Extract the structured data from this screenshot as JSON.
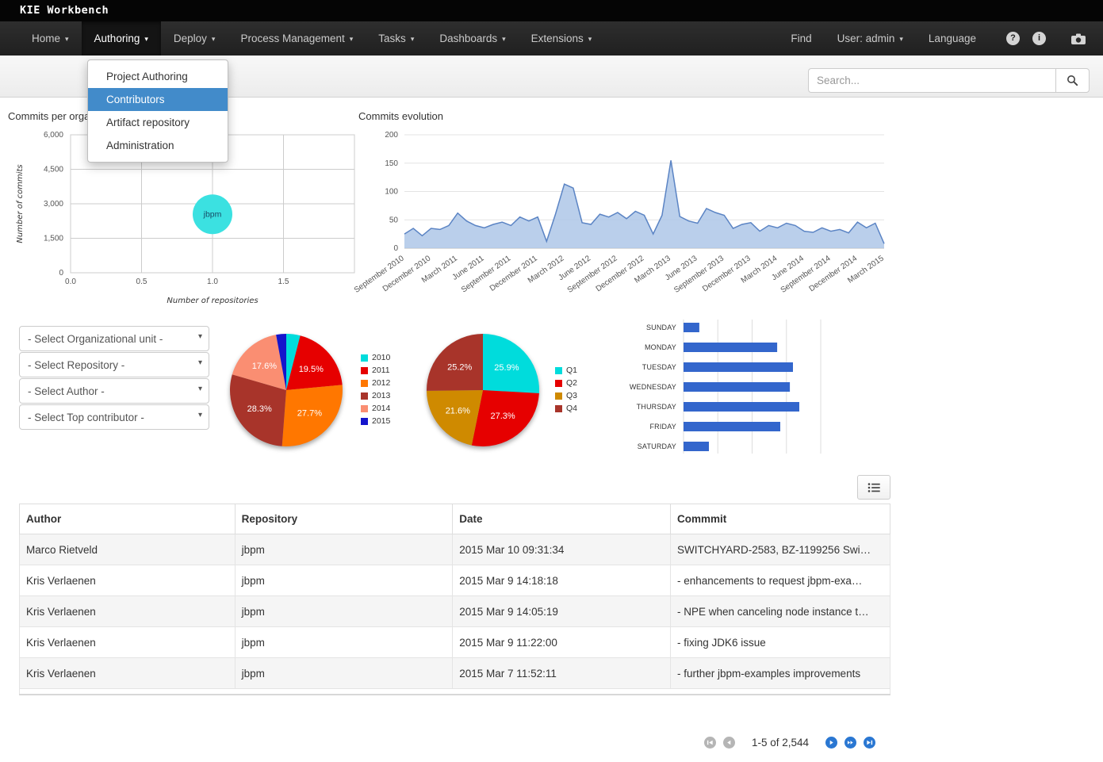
{
  "app": {
    "title": "KIE Workbench"
  },
  "navbar": {
    "items": [
      {
        "label": "Home",
        "caret": true,
        "active": false
      },
      {
        "label": "Authoring",
        "caret": true,
        "active": true
      },
      {
        "label": "Deploy",
        "caret": true,
        "active": false
      },
      {
        "label": "Process Management",
        "caret": true,
        "active": false
      },
      {
        "label": "Tasks",
        "caret": true,
        "active": false
      },
      {
        "label": "Dashboards",
        "caret": true,
        "active": false
      },
      {
        "label": "Extensions",
        "caret": true,
        "active": false
      }
    ],
    "right_items": [
      {
        "label": "Find",
        "caret": false
      },
      {
        "label": "User: admin",
        "caret": true
      },
      {
        "label": "Language",
        "caret": false
      }
    ],
    "icon_names": [
      "help-icon",
      "info-icon",
      "screenshot-icon"
    ]
  },
  "authoring_menu": {
    "items": [
      {
        "label": "Project Authoring",
        "selected": false
      },
      {
        "label": "Contributors",
        "selected": true
      },
      {
        "label": "Artifact repository",
        "selected": false
      },
      {
        "label": "Administration",
        "selected": false
      }
    ]
  },
  "search": {
    "placeholder": "Search..."
  },
  "filters": [
    "- Select Organizational unit -",
    "- Select Repository -",
    "- Select Author -",
    "- Select Top contributor -"
  ],
  "chart_data": [
    {
      "type": "scatter",
      "title": "Commits per organization",
      "xlabel": "Number of repositories",
      "ylabel": "Number of commits",
      "xlim": [
        0,
        2
      ],
      "ylim": [
        0,
        6000
      ],
      "xticks": [
        0,
        0.5,
        1,
        1.5
      ],
      "yticks": [
        0,
        1500,
        3000,
        4500,
        6000
      ],
      "points": [
        {
          "label": "jbpm",
          "x": 1,
          "y": 2544,
          "color": "#3be1e1"
        }
      ]
    },
    {
      "type": "area",
      "title": "Commits evolution",
      "ylim": [
        0,
        200
      ],
      "yticks": [
        0,
        50,
        100,
        150,
        200
      ],
      "label_every": 3,
      "x": [
        "September 2010",
        "December 2010",
        "March 2011",
        "June 2011",
        "September 2011",
        "December 2011",
        "March 2012",
        "June 2012",
        "September 2012",
        "December 2012",
        "March 2013",
        "June 2013",
        "September 2013",
        "December 2013",
        "March 2014",
        "June 2014",
        "September 2014",
        "December 2014",
        "March 2015"
      ],
      "values": [
        25,
        35,
        22,
        35,
        33,
        40,
        62,
        48,
        40,
        36,
        42,
        46,
        40,
        55,
        48,
        55,
        12,
        60,
        113,
        106,
        45,
        42,
        60,
        55,
        63,
        52,
        65,
        58,
        25,
        58,
        155,
        56,
        48,
        44,
        70,
        63,
        58,
        35,
        42,
        45,
        30,
        40,
        36,
        44,
        40,
        30,
        28,
        36,
        30,
        33,
        27,
        46,
        36,
        44,
        8
      ],
      "fill": "#aec7e8",
      "line": "#5b84c4"
    },
    {
      "type": "pie",
      "slices": [
        {
          "label": "2010",
          "value": 4.0,
          "color": "#00dcdc"
        },
        {
          "label": "2011",
          "value": 19.5,
          "color": "#e60000"
        },
        {
          "label": "2012",
          "value": 27.7,
          "color": "#ff7700"
        },
        {
          "label": "2013",
          "value": 28.3,
          "color": "#a8342a"
        },
        {
          "label": "2014",
          "value": 17.6,
          "color": "#fa8e72"
        },
        {
          "label": "2015",
          "value": 2.9,
          "color": "#1414cc"
        }
      ]
    },
    {
      "type": "pie",
      "slices": [
        {
          "label": "Q1",
          "value": 25.9,
          "color": "#00dcdc"
        },
        {
          "label": "Q2",
          "value": 27.3,
          "color": "#e60000"
        },
        {
          "label": "Q3",
          "value": 21.6,
          "color": "#cf8a00"
        },
        {
          "label": "Q4",
          "value": 25.2,
          "color": "#a8342a"
        }
      ]
    },
    {
      "type": "bar",
      "orientation": "horizontal",
      "categories": [
        "SUNDAY",
        "MONDAY",
        "TUESDAY",
        "WEDNESDAY",
        "THURSDAY",
        "FRIDAY",
        "SATURDAY"
      ],
      "values": [
        92,
        546,
        638,
        620,
        675,
        564,
        148
      ],
      "xlim": [
        0,
        800
      ],
      "color": "#3366cc"
    }
  ],
  "table": {
    "columns": [
      "Author",
      "Repository",
      "Date",
      "Commmit"
    ],
    "rows": [
      [
        "Marco Rietveld",
        "jbpm",
        "2015 Mar 10 09:31:34",
        "SWITCHYARD-2583, BZ-1199256 Swi…"
      ],
      [
        "Kris Verlaenen",
        "jbpm",
        "2015 Mar 9 14:18:18",
        "- enhancements to request jbpm-exa…"
      ],
      [
        "Kris Verlaenen",
        "jbpm",
        "2015 Mar 9 14:05:19",
        "- NPE when canceling node instance t…"
      ],
      [
        "Kris Verlaenen",
        "jbpm",
        "2015 Mar 9 11:22:00",
        "- fixing JDK6 issue"
      ],
      [
        "Kris Verlaenen",
        "jbpm",
        "2015 Mar 7 11:52:11",
        "- further jbpm-examples improvements"
      ]
    ]
  },
  "pagination": {
    "label": "1-5 of 2,544"
  },
  "colors": {
    "accent_blue": "#428bca",
    "bar_blue": "#3366cc",
    "bubble_cyan": "#3be1e1",
    "area_fill": "#aec7e8",
    "area_line": "#5b84c4"
  }
}
